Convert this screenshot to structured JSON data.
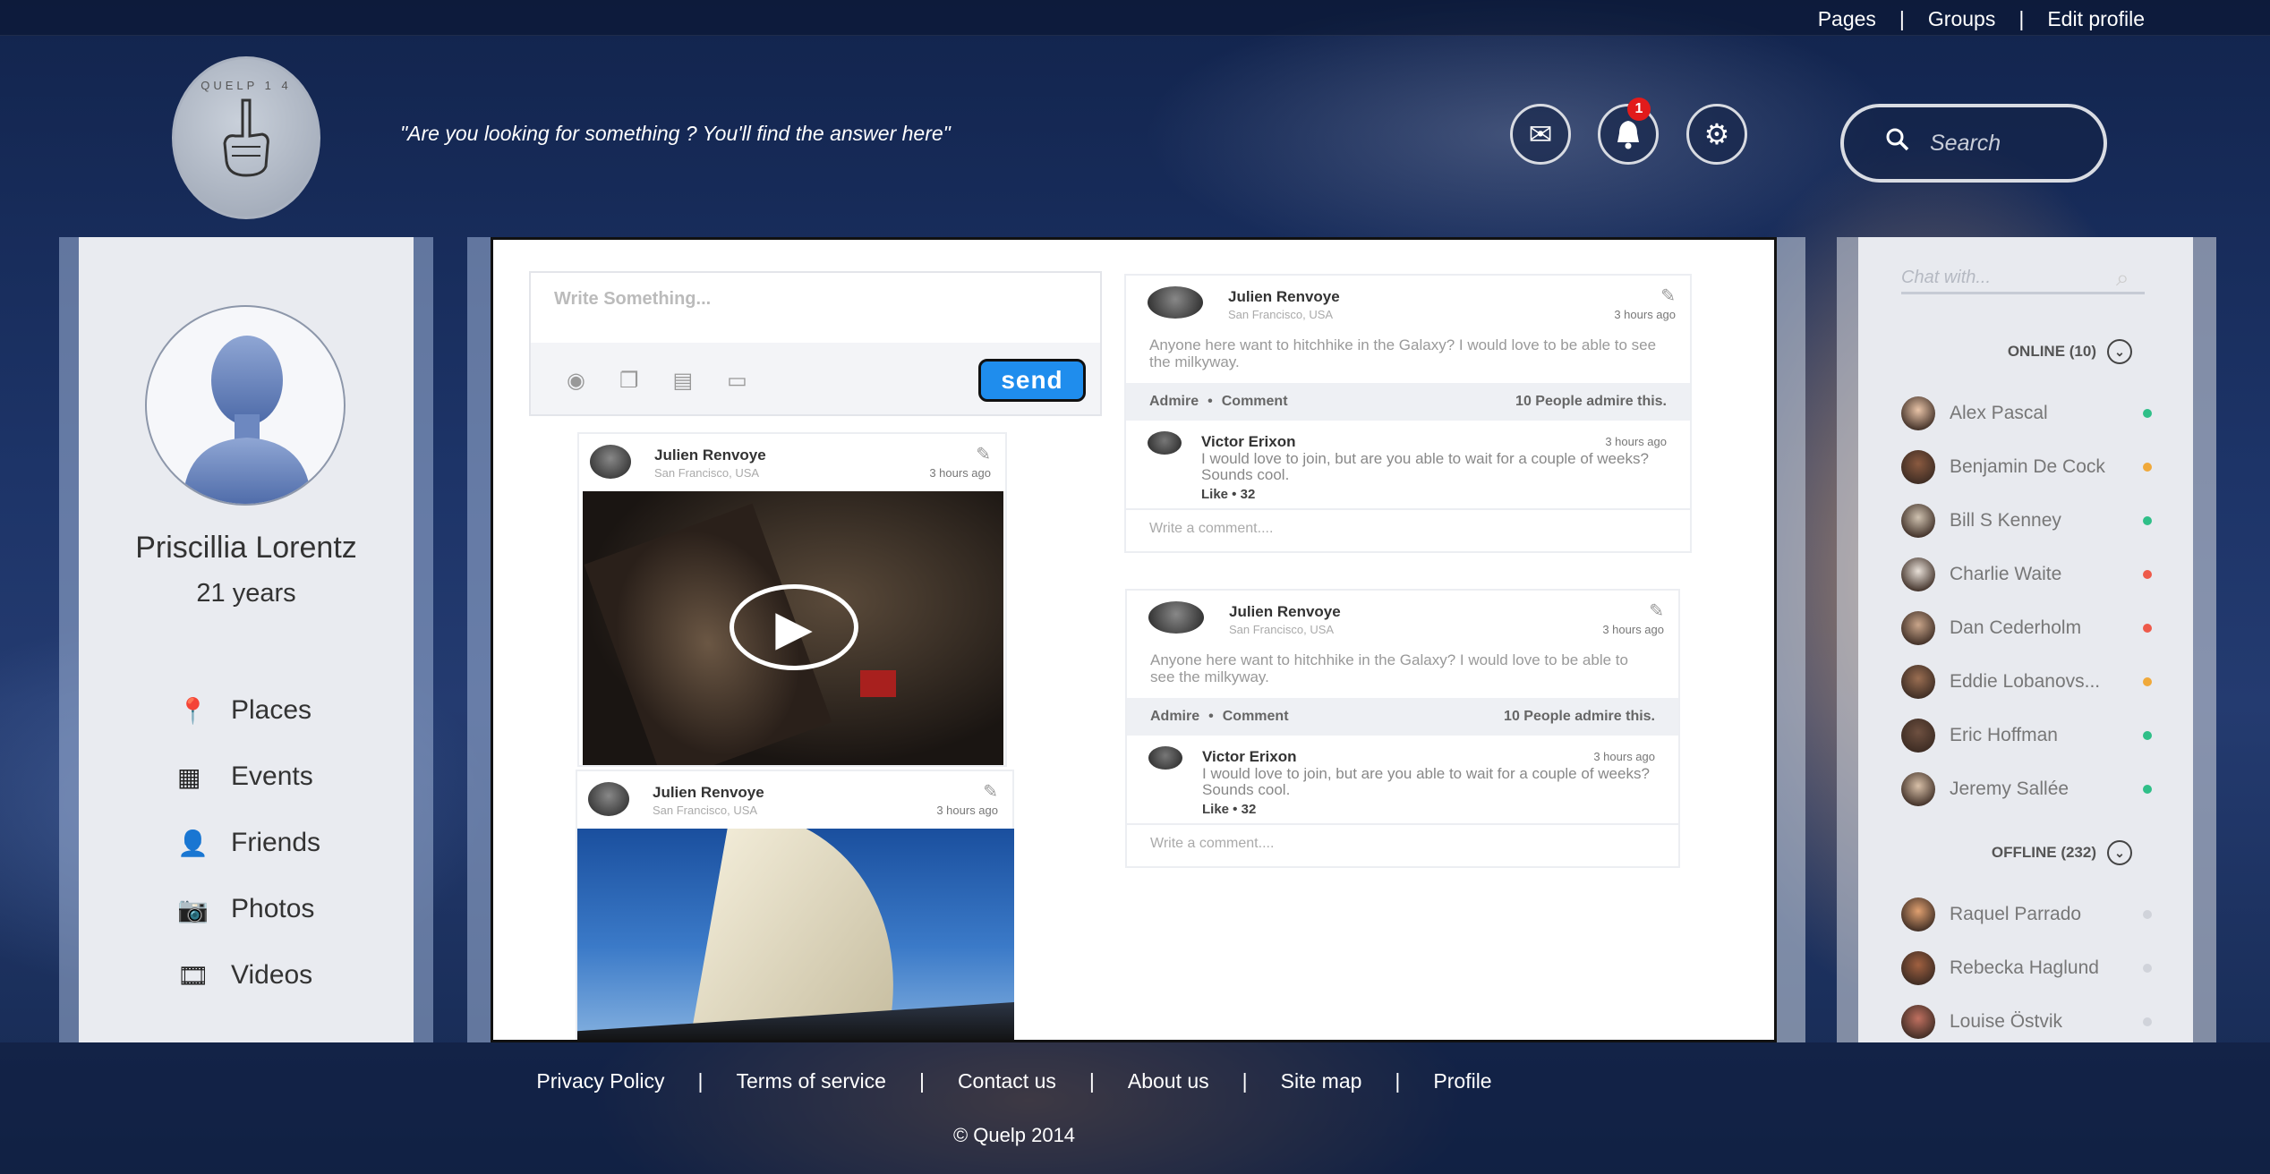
{
  "header": {
    "top_links": [
      "Pages",
      "Groups",
      "Edit profile"
    ],
    "logo_text": "QUELP 1 4",
    "tagline": "\"Are you looking for something ? You'll find the answer here\"",
    "notification_count": "1",
    "search_placeholder": "Search",
    "icons": [
      "mail-icon",
      "bell-icon",
      "gear-icon",
      "search-icon"
    ]
  },
  "profile": {
    "name": "Priscillia Lorentz",
    "age": "21 years",
    "nav": [
      {
        "label": "Places",
        "icon": "map-pin-icon"
      },
      {
        "label": "Events",
        "icon": "calendar-icon"
      },
      {
        "label": "Friends",
        "icon": "user-icon"
      },
      {
        "label": "Photos",
        "icon": "camera-icon"
      },
      {
        "label": "Videos",
        "icon": "film-icon"
      }
    ]
  },
  "composer": {
    "placeholder": "Write Something...",
    "send_label": "send",
    "tools": [
      "location-icon",
      "gallery-icon",
      "calendar-icon",
      "video-icon"
    ]
  },
  "media_posts": [
    {
      "author": "Julien Renvoye",
      "location": "San Francisco, USA",
      "time": "3 hours ago",
      "type": "video"
    },
    {
      "author": "Julien Renvoye",
      "location": "San Francisco, USA",
      "time": "3 hours ago",
      "type": "photo"
    }
  ],
  "text_posts": [
    {
      "author": "Julien Renvoye",
      "location": "San Francisco, USA",
      "time": "3 hours ago",
      "text": "Anyone here want to hitchhike in the Galaxy? I would love to be able to see the milkyway.",
      "admire": "Admire",
      "comment": "Comment",
      "admire_count": "10 People admire this.",
      "reply": {
        "author": "Victor Erixon",
        "time": "3 hours ago",
        "text": "I would love to join, but are you able to wait for a couple of weeks? Sounds cool.",
        "like": "Like",
        "like_count": "32"
      },
      "write_comment": "Write a comment...."
    },
    {
      "author": "Julien Renvoye",
      "location": "San Francisco, USA",
      "time": "3 hours ago",
      "text": "Anyone here want to hitchhike in the Galaxy? I would love to be able to see the milkyway.",
      "admire": "Admire",
      "comment": "Comment",
      "admire_count": "10 People admire this.",
      "reply": {
        "author": "Victor Erixon",
        "time": "3 hours ago",
        "text": "I would love to join, but are you able to wait for a couple of weeks? Sounds cool.",
        "like": "Like",
        "like_count": "32"
      },
      "write_comment": "Write a comment...."
    }
  ],
  "chat": {
    "placeholder": "Chat with...",
    "online_label": "ONLINE (10)",
    "offline_label": "OFFLINE (232)",
    "online": [
      {
        "name": "Alex Pascal",
        "status": "#2fbf88"
      },
      {
        "name": "Benjamin De Cock",
        "status": "#f0a93a"
      },
      {
        "name": "Bill S Kenney",
        "status": "#2fbf88"
      },
      {
        "name": "Charlie Waite",
        "status": "#ee5a4a"
      },
      {
        "name": "Dan Cederholm",
        "status": "#ee5a4a"
      },
      {
        "name": "Eddie Lobanovs...",
        "status": "#f0a93a"
      },
      {
        "name": "Eric Hoffman",
        "status": "#2fbf88"
      },
      {
        "name": "Jeremy Sallée",
        "status": "#2fbf88"
      }
    ],
    "offline": [
      {
        "name": "Raquel Parrado",
        "status": "#d0d3da"
      },
      {
        "name": "Rebecka Haglund",
        "status": "#d0d3da"
      },
      {
        "name": "Louise Östvik",
        "status": "#d0d3da"
      }
    ]
  },
  "footer": {
    "links": [
      "Privacy Policy",
      "Terms of service",
      "Contact us",
      "About us",
      "Site map",
      "Profile"
    ],
    "copyright": "© Quelp 2014"
  }
}
